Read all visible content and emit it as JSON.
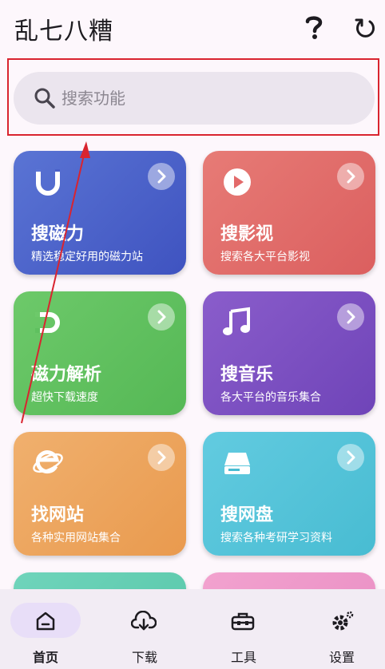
{
  "app": {
    "title": "乱七八糟"
  },
  "search": {
    "placeholder": "搜索功能",
    "value": ""
  },
  "cards": [
    {
      "title": "搜磁力",
      "subtitle": "精选稳定好用的磁力站",
      "icon": "magnet-u-icon"
    },
    {
      "title": "搜影视",
      "subtitle": "搜索各大平台影视",
      "icon": "play-circle-icon"
    },
    {
      "title": "磁力解析",
      "subtitle": "超快下载速度",
      "icon": "magnet-link-icon"
    },
    {
      "title": "搜音乐",
      "subtitle": "各大平台的音乐集合",
      "icon": "music-note-icon"
    },
    {
      "title": "找网站",
      "subtitle": "各种实用网站集合",
      "icon": "ie-browser-icon"
    },
    {
      "title": "搜网盘",
      "subtitle": "搜索各种考研学习资料",
      "icon": "drive-icon"
    }
  ],
  "nav": [
    {
      "label": "首页",
      "icon": "home-icon",
      "active": true
    },
    {
      "label": "下载",
      "icon": "cloud-download-icon",
      "active": false
    },
    {
      "label": "工具",
      "icon": "toolbox-icon",
      "active": false
    },
    {
      "label": "设置",
      "icon": "settings-icon",
      "active": false
    }
  ],
  "colors": {
    "annotation": "#d9242f",
    "nav_active_pill": "#e8def8",
    "card_blue": "#4a5fc9",
    "card_red": "#e36a6a",
    "card_green": "#5fc05f",
    "card_purple": "#7a4fc0",
    "card_orange": "#eea35a",
    "card_cyan": "#54c4d8"
  }
}
